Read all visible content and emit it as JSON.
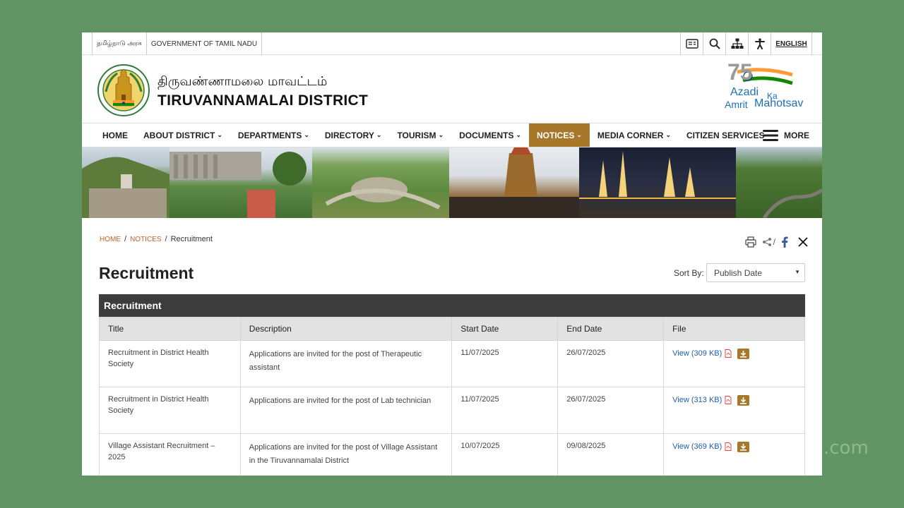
{
  "topbar": {
    "gov_ta": "தமிழ்நாடு அரசு",
    "gov_en": "GOVERNMENT OF TAMIL NADU",
    "language": "ENGLISH"
  },
  "header": {
    "district_ta": "திருவண்ணாமலை மாவட்டம்",
    "district_en": "TIRUVANNAMALAI DISTRICT",
    "azadi": {
      "number": "75",
      "line1": "Azadi",
      "ka": "Ka",
      "line2a": "Amrit",
      "line2b": "Mahotsav"
    }
  },
  "nav": {
    "items": [
      {
        "label": "HOME",
        "dropdown": false
      },
      {
        "label": "ABOUT DISTRICT",
        "dropdown": true
      },
      {
        "label": "DEPARTMENTS",
        "dropdown": true
      },
      {
        "label": "DIRECTORY",
        "dropdown": true
      },
      {
        "label": "TOURISM",
        "dropdown": true
      },
      {
        "label": "DOCUMENTS",
        "dropdown": true
      },
      {
        "label": "NOTICES",
        "dropdown": true,
        "active": true
      },
      {
        "label": "MEDIA CORNER",
        "dropdown": true
      },
      {
        "label": "CITIZEN SERVICES",
        "dropdown": false
      }
    ],
    "more": "MORE"
  },
  "breadcrumb": {
    "home": "HOME",
    "notices": "NOTICES",
    "current": "Recruitment"
  },
  "page": {
    "title": "Recruitment",
    "sort_label": "Sort By:",
    "sort_value": "Publish Date"
  },
  "table": {
    "caption": "Recruitment",
    "headers": [
      "Title",
      "Description",
      "Start Date",
      "End Date",
      "File"
    ],
    "rows": [
      {
        "title": "Recruitment in District Health Society",
        "description": "Applications are invited for the post of Therapeutic assistant",
        "start": "11/07/2025",
        "end": "26/07/2025",
        "file": "View (309 KB)"
      },
      {
        "title": "Recruitment in District Health Society",
        "description": "Applications are invited for the post of Lab technician",
        "start": "11/07/2025",
        "end": "26/07/2025",
        "file": "View (313 KB)"
      },
      {
        "title": "Village Assistant Recruitment – 2025",
        "description": "Applications are invited for the post of Village Assistant in the Tiruvannamalai District",
        "start": "10/07/2025",
        "end": "09/08/2025",
        "file": "View (369 KB)"
      }
    ]
  },
  "watermark": ".com",
  "colors": {
    "accent": "#a8782a",
    "link": "#1f5bb0",
    "crumb": "#c6602a",
    "table_head": "#3c3c3c",
    "background": "#629563"
  }
}
